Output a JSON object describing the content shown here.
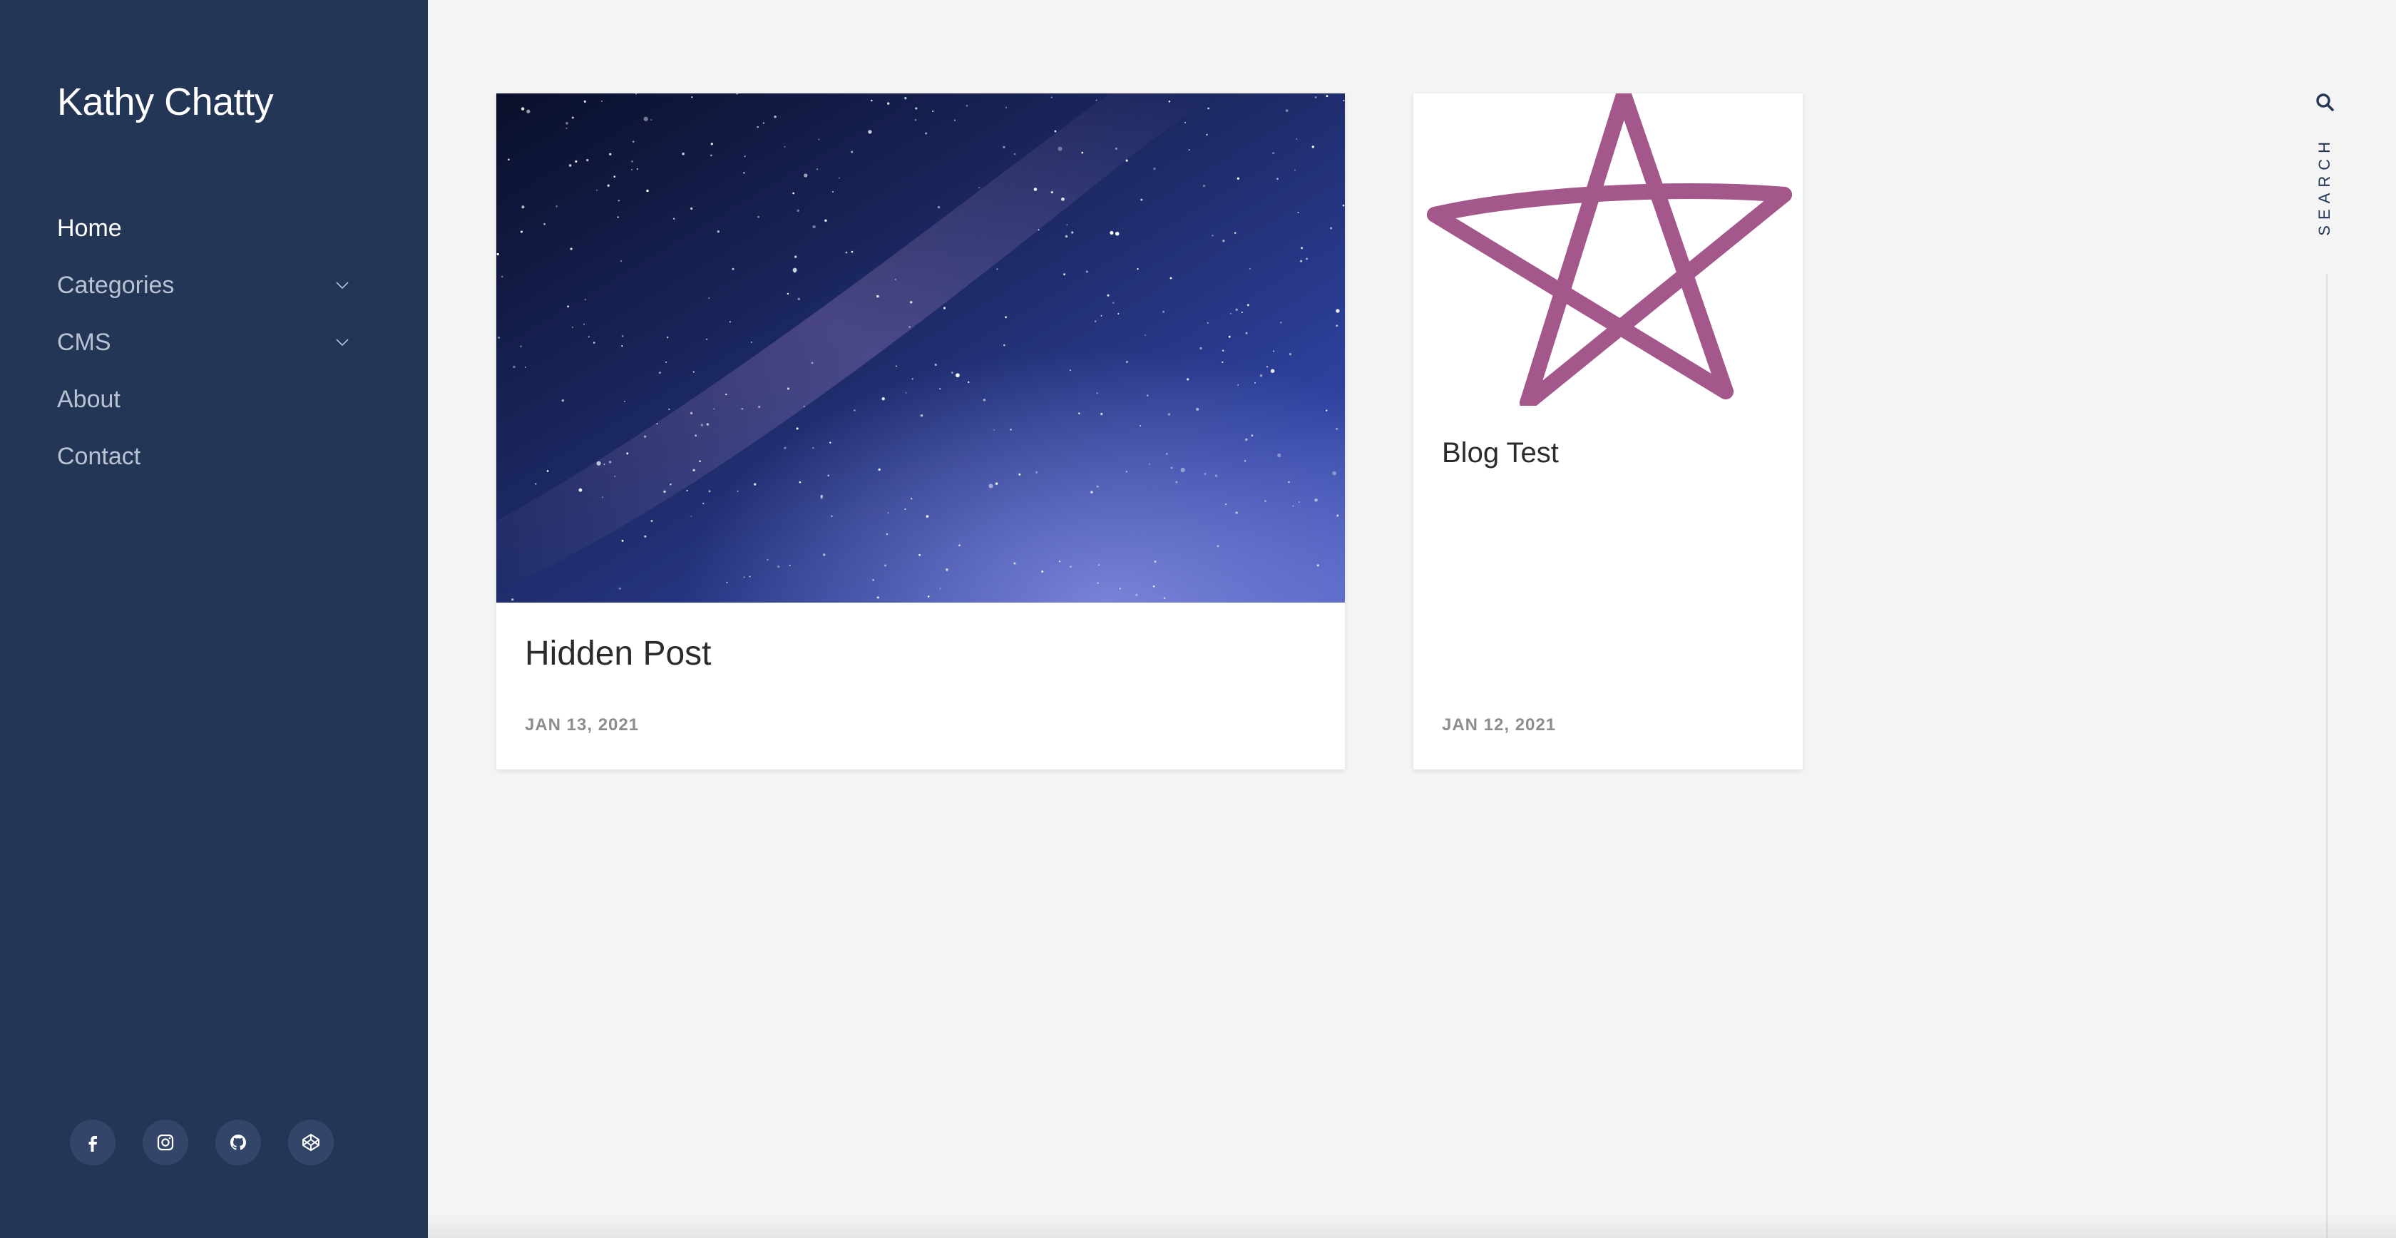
{
  "site": {
    "title": "Kathy Chatty"
  },
  "nav": {
    "items": [
      {
        "label": "Home",
        "active": true,
        "has_submenu": false
      },
      {
        "label": "Categories",
        "active": false,
        "has_submenu": true
      },
      {
        "label": "CMS",
        "active": false,
        "has_submenu": true
      },
      {
        "label": "About",
        "active": false,
        "has_submenu": false
      },
      {
        "label": "Contact",
        "active": false,
        "has_submenu": false
      }
    ]
  },
  "socials": [
    {
      "name": "facebook-icon"
    },
    {
      "name": "instagram-icon"
    },
    {
      "name": "github-icon"
    },
    {
      "name": "codepen-icon"
    }
  ],
  "posts": [
    {
      "title": "Hidden Post",
      "date": "JAN 13, 2021",
      "image": "starry-night-sky-image"
    },
    {
      "title": "Blog Test",
      "date": "JAN 12, 2021",
      "image": "pink-star-drawing-image"
    }
  ],
  "search": {
    "label": "SEARCH",
    "icon": "search-icon"
  },
  "colors": {
    "sidebar_bg": "#243656",
    "page_bg": "#f4f4f4",
    "star": "#a3578a"
  }
}
